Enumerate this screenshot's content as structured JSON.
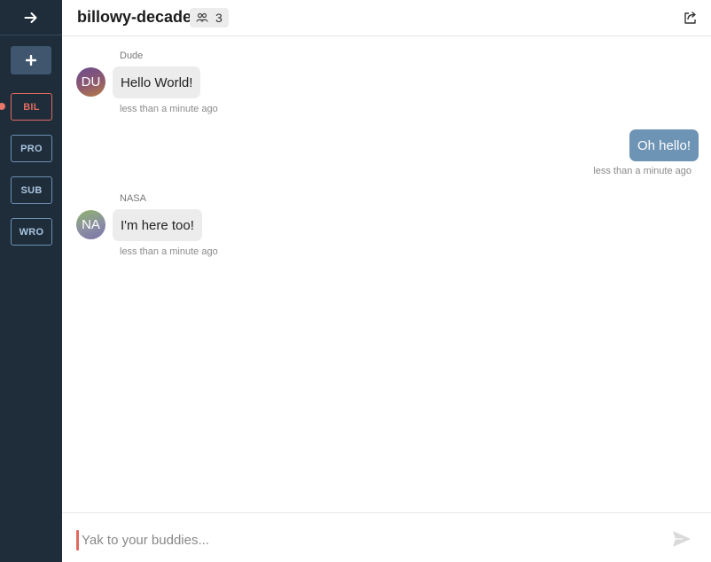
{
  "sidebar": {
    "add_label": "+",
    "rooms": [
      {
        "label": "BIL",
        "active": true
      },
      {
        "label": "PRO",
        "active": false
      },
      {
        "label": "SUB",
        "active": false
      },
      {
        "label": "WRO",
        "active": false
      }
    ]
  },
  "header": {
    "room_name": "billowy-decade",
    "member_count": "3"
  },
  "messages": [
    {
      "author": "Dude",
      "initials": "DU",
      "text": "Hello World!",
      "time": "less than a minute ago",
      "direction": "incoming"
    },
    {
      "author": "",
      "initials": "",
      "text": "Oh hello!",
      "time": "less than a minute ago",
      "direction": "outgoing"
    },
    {
      "author": "NASA",
      "initials": "NA",
      "text": "I'm here too!",
      "time": "less than a minute ago",
      "direction": "incoming"
    }
  ],
  "composer": {
    "placeholder": "Yak to your buddies..."
  },
  "colors": {
    "sidebar_bg": "#1f2d3a",
    "accent_active": "#e06a5f",
    "outgoing_bubble": "#6d93b5",
    "incoming_bubble": "#ececec"
  }
}
